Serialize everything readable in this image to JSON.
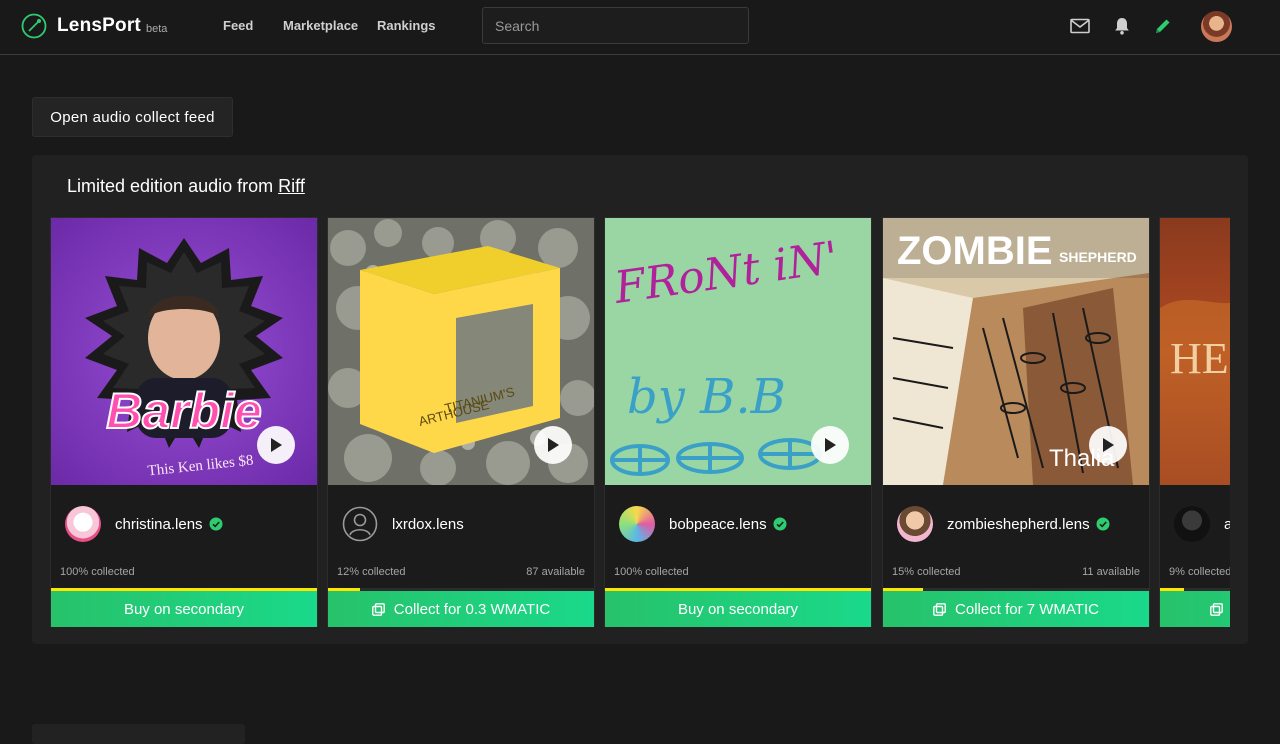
{
  "app": {
    "name": "LensPort",
    "badge": "beta",
    "accent": "#2ecc71"
  },
  "nav": {
    "feed": "Feed",
    "marketplace": "Marketplace",
    "rankings": "Rankings",
    "search_placeholder": "Search"
  },
  "toolbar_icons": [
    "mail-icon",
    "bell-icon",
    "pencil-icon",
    "avatar"
  ],
  "feed_button": "Open audio collect feed",
  "panel": {
    "title_prefix": "Limited edition audio from",
    "title_link": "Riff"
  },
  "cards": [
    {
      "art_text": [
        "Barbie",
        "This Ken likes $8"
      ],
      "user": "christina.lens",
      "verified": true,
      "collected": "100% collected",
      "available": "",
      "progress": 1.0,
      "button": "Buy on secondary",
      "button_icon": ""
    },
    {
      "art_text": [
        "TITANIUM'S",
        "ARTHOUSE"
      ],
      "user": "lxrdox.lens",
      "verified": false,
      "collected": "12% collected",
      "available": "87 available",
      "progress": 0.12,
      "button": "Collect for 0.3 WMATIC",
      "button_icon": "copy-icon"
    },
    {
      "art_text": [
        "FRoNt iN'",
        "by B.B"
      ],
      "user": "bobpeace.lens",
      "verified": true,
      "collected": "100% collected",
      "available": "",
      "progress": 1.0,
      "button": "Buy on secondary",
      "button_icon": ""
    },
    {
      "art_text": [
        "ZOMBIE",
        "SHEPHERD",
        "Thalia"
      ],
      "user": "zombieshepherd.lens",
      "verified": true,
      "collected": "15% collected",
      "available": "11 available",
      "progress": 0.15,
      "button": "Collect for 7 WMATIC",
      "button_icon": "copy-icon"
    },
    {
      "art_text": [
        "HE"
      ],
      "user": "a",
      "verified": false,
      "collected": "9% collected",
      "available": "",
      "progress": 0.09,
      "button": "",
      "button_icon": "copy-icon"
    }
  ]
}
